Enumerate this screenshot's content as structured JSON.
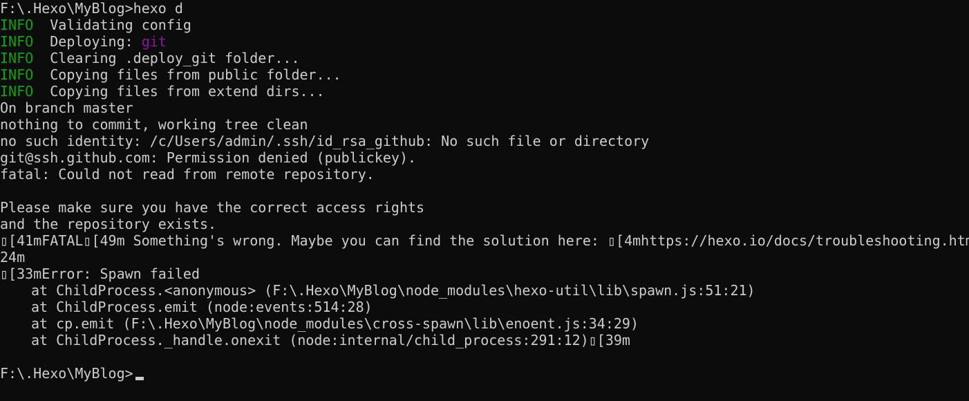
{
  "colors": {
    "background": "#0c0c0c",
    "text": "#cccccc",
    "info": "#13a10e",
    "git": "#881798"
  },
  "terminal": {
    "prompt_command": "F:\\.Hexo\\MyBlog>hexo d",
    "info_tag": "INFO",
    "info_lines": {
      "validating": "Validating config",
      "deploying_label": "Deploying: ",
      "deploying_target": "git",
      "clearing": "Clearing .deploy_git folder...",
      "copying_public": "Copying files from public folder...",
      "copying_extend": "Copying files from extend dirs..."
    },
    "git_output": {
      "branch": "On branch master",
      "nothing": "nothing to commit, working tree clean",
      "no_identity": "no such identity: /c/Users/admin/.ssh/id_rsa_github: No such file or directory",
      "permission": "git@ssh.github.com: Permission denied (publickey).",
      "fatal": "fatal: Could not read from remote repository.",
      "please": "Please make sure you have the correct access rights",
      "and_repo": "and the repository exists."
    },
    "error_block": {
      "fatal_line": "▯[41mFATAL▯[49m Something's wrong. Maybe you can find the solution here: ▯[4mhttps://hexo.io/docs/troubleshooting.htm",
      "fatal_wrap": "24m",
      "error_line": "▯[33mError: Spawn failed",
      "stack": [
        "at ChildProcess.<anonymous> (F:\\.Hexo\\MyBlog\\node_modules\\hexo-util\\lib\\spawn.js:51:21)",
        "at ChildProcess.emit (node:events:514:28)",
        "at cp.emit (F:\\.Hexo\\MyBlog\\node_modules\\cross-spawn\\lib\\enoent.js:34:29)",
        "at ChildProcess._handle.onexit (node:internal/child_process:291:12)▯[39m"
      ]
    },
    "final_prompt": "F:\\.Hexo\\MyBlog>"
  }
}
